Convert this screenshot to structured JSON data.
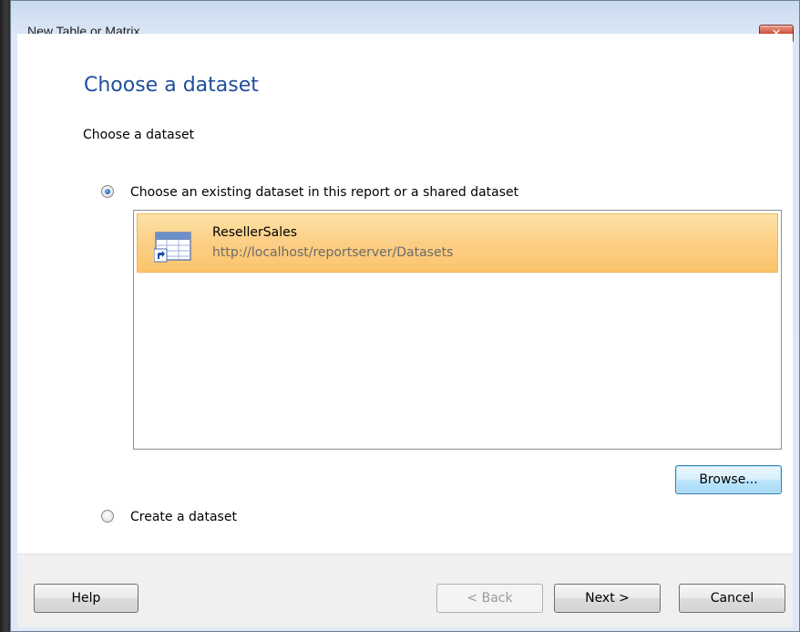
{
  "window": {
    "title": "New Table or Matrix",
    "close_glyph": "✕"
  },
  "page": {
    "heading": "Choose a dataset",
    "subheading": "Choose a dataset"
  },
  "options": {
    "existing_label": "Choose an existing dataset in this report or a shared dataset",
    "existing_selected": true,
    "create_label": "Create a dataset",
    "create_selected": false
  },
  "datasets": [
    {
      "name": "ResellerSales",
      "path": "http://localhost/reportserver/Datasets",
      "icon": "shared-dataset-icon",
      "selected": true
    }
  ],
  "buttons": {
    "browse": "Browse...",
    "help": "Help",
    "back": "< Back",
    "next": "Next >",
    "cancel": "Cancel"
  },
  "colors": {
    "heading": "#1f4e9c",
    "selection": "#fbc46c",
    "close_button": "#c0381f"
  }
}
